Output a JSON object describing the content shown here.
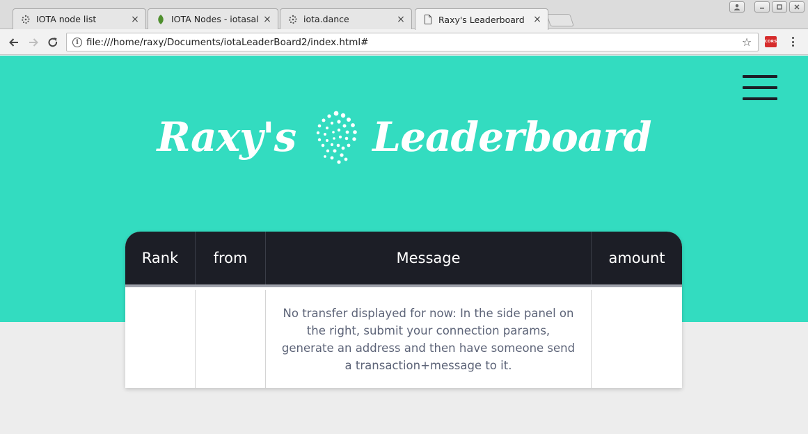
{
  "browser": {
    "tabs": [
      {
        "label": "IOTA node list",
        "icon": "iota-icon",
        "active": false
      },
      {
        "label": "IOTA Nodes - iotasalad",
        "icon": "leaf-icon",
        "active": false
      },
      {
        "label": "iota.dance",
        "icon": "iota-icon",
        "active": false
      },
      {
        "label": "Raxy's Leaderboard",
        "icon": "page-icon",
        "active": true
      }
    ],
    "url": "file:///home/raxy/Documents/iotaLeaderBoard2/index.html#",
    "cors_badge": "CORS"
  },
  "page": {
    "title_left": "Raxy's",
    "title_right": "Leaderboard",
    "accent_color": "#33dcc0",
    "header_color": "#1c1e26",
    "table": {
      "columns": [
        "Rank",
        "from",
        "Message",
        "amount"
      ],
      "empty_message": "No transfer displayed for now: In the side panel on the right, submit your connection params, generate an address and then have someone send a transaction+message to it."
    }
  }
}
